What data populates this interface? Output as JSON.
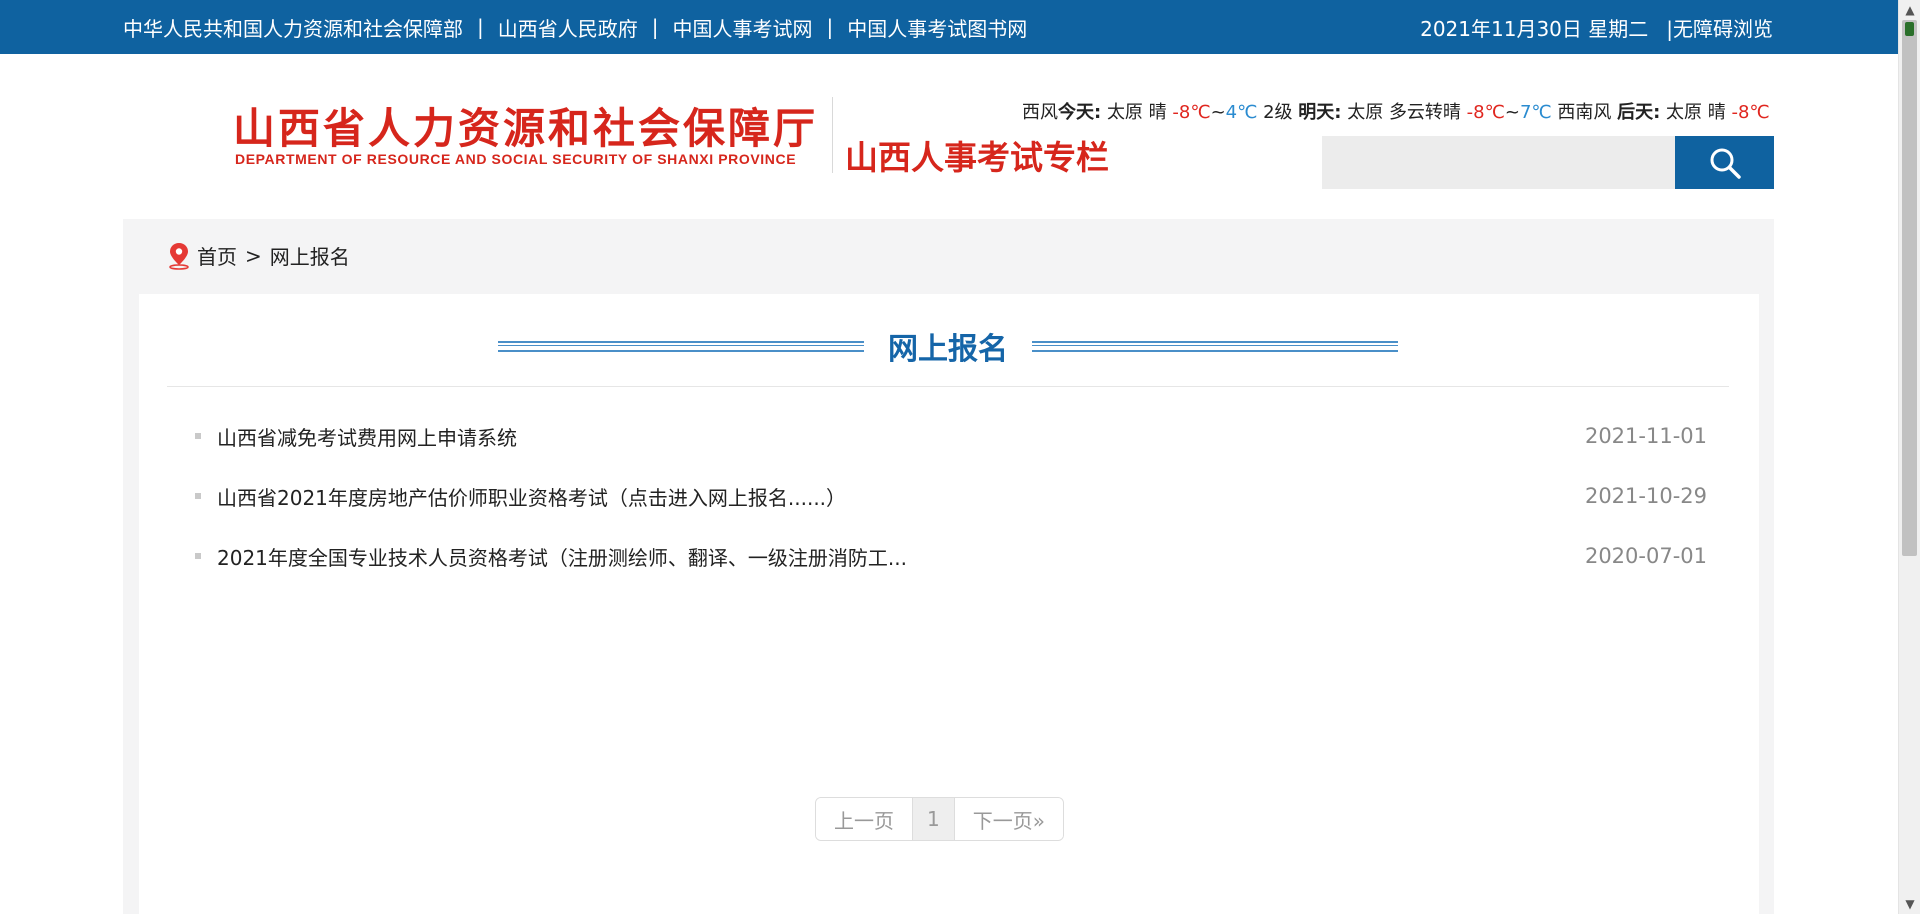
{
  "topbar": {
    "links": [
      "中华人民共和国人力资源和社会保障部",
      "山西省人民政府",
      "中国人事考试网",
      "中国人事考试图书网"
    ],
    "separator": "|",
    "date": "2021年11月30日 星期二",
    "accessibility": "|无障碍浏览"
  },
  "header": {
    "logo_main": "山西省人力资源和社会保障厅",
    "logo_en": "DEPARTMENT OF RESOURCE AND SOCIAL SECURITY OF SHANXI PROVINCE",
    "logo_sub": "山西人事考试专栏"
  },
  "weather": {
    "lead": "西风",
    "today_label": "今天:",
    "today_city": "太原",
    "today_cond": "晴",
    "today_low": "-8℃",
    "tilde": "~",
    "today_high": "4℃",
    "today_wind": "2级",
    "tomorrow_label": "明天:",
    "tomorrow_city": "太原",
    "tomorrow_cond": "多云转晴",
    "tomorrow_low": "-8℃",
    "tomorrow_high": "7℃",
    "tomorrow_wind": "西南风",
    "after_label": "后天:",
    "after_city": "太原",
    "after_cond": "晴",
    "after_low": "-8℃"
  },
  "search": {
    "placeholder": "",
    "icon": "search-icon"
  },
  "breadcrumb": {
    "home": "首页",
    "sep": ">",
    "current": "网上报名"
  },
  "section": {
    "title": "网上报名"
  },
  "news": [
    {
      "title": "山西省减免考试费用网上申请系统",
      "date": "2021-11-01"
    },
    {
      "title": "山西省2021年度房地产估价师职业资格考试（点击进入网上报名......）",
      "date": "2021-10-29"
    },
    {
      "title": "2021年度全国专业技术人员资格考试（注册测绘师、翻译、一级注册消防工...",
      "date": "2020-07-01"
    }
  ],
  "pager": {
    "prev": "上一页",
    "current": "1",
    "next": "下一页»"
  },
  "colors": {
    "brand_blue": "#0f62a0",
    "logo_red": "#d6261c",
    "cold": "#e0261f",
    "warm": "#2a8bd0"
  }
}
